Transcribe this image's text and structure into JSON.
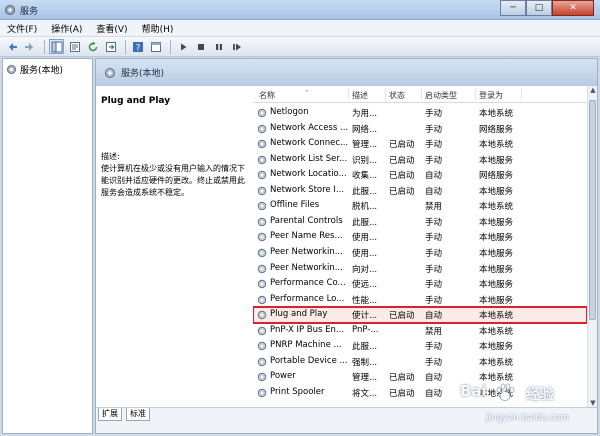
{
  "window": {
    "title": "服务",
    "buttons": {
      "minimize": "─",
      "maximize": "□",
      "close": "✕"
    }
  },
  "menubar": [
    "文件(F)",
    "操作(A)",
    "查看(V)",
    "帮助(H)"
  ],
  "toolbar": {
    "icons": [
      "back-icon",
      "forward-icon",
      "show-tree-icon",
      "properties-icon",
      "refresh-icon",
      "export-icon",
      "help-icon",
      "console-icon",
      "start-service-icon",
      "stop-service-icon",
      "pause-service-icon",
      "restart-service-icon"
    ]
  },
  "tree": {
    "root": "服务(本地)"
  },
  "header": {
    "title": "服务(本地)"
  },
  "description": {
    "service_name": "Plug and Play",
    "label": "描述:",
    "text": "使计算机在极少或没有用户输入的情况下能识别并适应硬件的更改。终止或禁用此服务会造成系统不稳定。"
  },
  "columns": {
    "name": "名称",
    "desc": "描述",
    "status": "状态",
    "startup": "启动类型",
    "logon": "登录为"
  },
  "services": [
    {
      "name": "Netlogon",
      "desc": "为用...",
      "status": "",
      "startup": "手动",
      "logon": "本地系统"
    },
    {
      "name": "Network Access ...",
      "desc": "网络...",
      "status": "",
      "startup": "手动",
      "logon": "网络服务"
    },
    {
      "name": "Network Connec...",
      "desc": "管理...",
      "status": "已启动",
      "startup": "手动",
      "logon": "本地系统"
    },
    {
      "name": "Network List Ser...",
      "desc": "识别...",
      "status": "已启动",
      "startup": "手动",
      "logon": "本地服务"
    },
    {
      "name": "Network Locatio...",
      "desc": "收集...",
      "status": "已启动",
      "startup": "自动",
      "logon": "网络服务"
    },
    {
      "name": "Network Store I...",
      "desc": "此服...",
      "status": "已启动",
      "startup": "自动",
      "logon": "本地服务"
    },
    {
      "name": "Offline Files",
      "desc": "脱机...",
      "status": "",
      "startup": "禁用",
      "logon": "本地系统"
    },
    {
      "name": "Parental Controls",
      "desc": "此服...",
      "status": "",
      "startup": "手动",
      "logon": "本地服务"
    },
    {
      "name": "Peer Name Res...",
      "desc": "使用...",
      "status": "",
      "startup": "手动",
      "logon": "本地服务"
    },
    {
      "name": "Peer Networkin...",
      "desc": "使用...",
      "status": "",
      "startup": "手动",
      "logon": "本地服务"
    },
    {
      "name": "Peer Networkin...",
      "desc": "向对...",
      "status": "",
      "startup": "手动",
      "logon": "本地服务"
    },
    {
      "name": "Performance Co...",
      "desc": "使远...",
      "status": "",
      "startup": "手动",
      "logon": "本地服务"
    },
    {
      "name": "Performance Lo...",
      "desc": "性能...",
      "status": "",
      "startup": "手动",
      "logon": "本地服务"
    },
    {
      "name": "Plug and Play",
      "desc": "使计...",
      "status": "已启动",
      "startup": "自动",
      "logon": "本地系统",
      "highlighted": true
    },
    {
      "name": "PnP-X IP Bus En...",
      "desc": "PnP-...",
      "status": "",
      "startup": "禁用",
      "logon": "本地系统"
    },
    {
      "name": "PNRP Machine ...",
      "desc": "此服...",
      "status": "",
      "startup": "手动",
      "logon": "本地服务"
    },
    {
      "name": "Portable Device ...",
      "desc": "强制...",
      "status": "",
      "startup": "手动",
      "logon": "本地系统"
    },
    {
      "name": "Power",
      "desc": "管理...",
      "status": "已启动",
      "startup": "自动",
      "logon": "本地系统"
    },
    {
      "name": "Print Spooler",
      "desc": "将文...",
      "status": "已启动",
      "startup": "自动",
      "logon": "本地系统"
    }
  ],
  "tabs": [
    "扩展",
    "标准"
  ],
  "watermark": {
    "brand": "Bai",
    "product": "经验",
    "url": "jingyan.baidu.com"
  }
}
